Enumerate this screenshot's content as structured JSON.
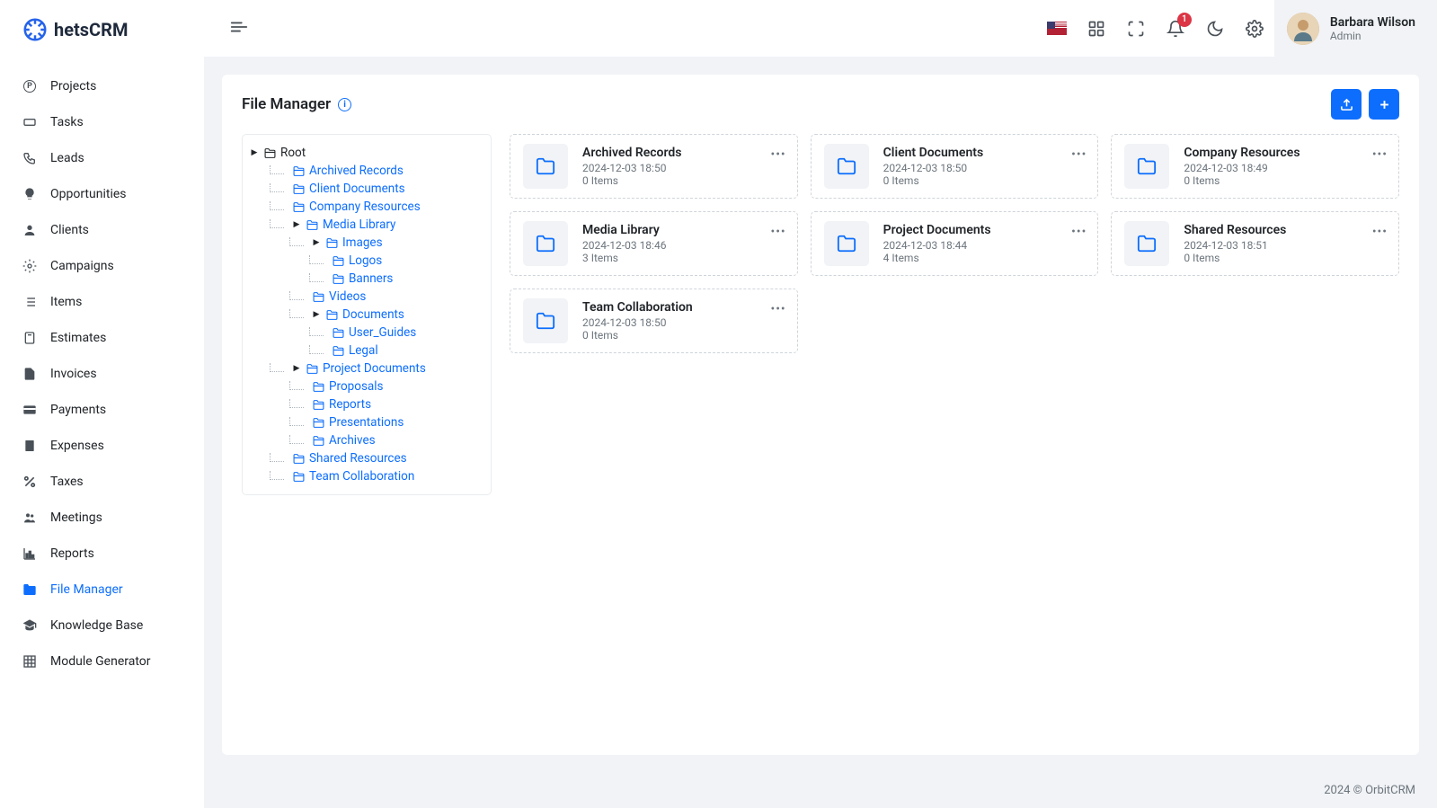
{
  "brand": {
    "prefix": "C",
    "suffix": "hetsCRM"
  },
  "user": {
    "name": "Barbara Wilson",
    "role": "Admin"
  },
  "notifications": {
    "count": "1"
  },
  "nav": [
    {
      "label": "Projects",
      "icon": "P"
    },
    {
      "label": "Tasks",
      "icon": "ticket"
    },
    {
      "label": "Leads",
      "icon": "phone"
    },
    {
      "label": "Opportunities",
      "icon": "bulb"
    },
    {
      "label": "Clients",
      "icon": "user"
    },
    {
      "label": "Campaigns",
      "icon": "gear"
    },
    {
      "label": "Items",
      "icon": "list"
    },
    {
      "label": "Estimates",
      "icon": "calc"
    },
    {
      "label": "Invoices",
      "icon": "file"
    },
    {
      "label": "Payments",
      "icon": "card"
    },
    {
      "label": "Expenses",
      "icon": "receipt"
    },
    {
      "label": "Taxes",
      "icon": "percent"
    },
    {
      "label": "Meetings",
      "icon": "group"
    },
    {
      "label": "Reports",
      "icon": "chart"
    },
    {
      "label": "File Manager",
      "icon": "folder",
      "active": true
    },
    {
      "label": "Knowledge Base",
      "icon": "grad"
    },
    {
      "label": "Module Generator",
      "icon": "grid"
    }
  ],
  "page": {
    "title": "File Manager"
  },
  "tree": {
    "root": "Root",
    "nodes": {
      "archived": "Archived Records",
      "client_docs": "Client Documents",
      "company_res": "Company Resources",
      "media": "Media Library",
      "images": "Images",
      "logos": "Logos",
      "banners": "Banners",
      "videos": "Videos",
      "docs": "Documents",
      "user_guides": "User_Guides",
      "legal": "Legal",
      "project_docs": "Project Documents",
      "proposals": "Proposals",
      "reports": "Reports",
      "presentations": "Presentations",
      "archives": "Archives",
      "shared": "Shared Resources",
      "team": "Team Collaboration"
    }
  },
  "folders": [
    {
      "name": "Archived Records",
      "date": "2024-12-03 18:50",
      "items": "0 Items"
    },
    {
      "name": "Client Documents",
      "date": "2024-12-03 18:50",
      "items": "0 Items"
    },
    {
      "name": "Company Resources",
      "date": "2024-12-03 18:49",
      "items": "0 Items"
    },
    {
      "name": "Media Library",
      "date": "2024-12-03 18:46",
      "items": "3 Items"
    },
    {
      "name": "Project Documents",
      "date": "2024-12-03 18:44",
      "items": "4 Items"
    },
    {
      "name": "Shared Resources",
      "date": "2024-12-03 18:51",
      "items": "0 Items"
    },
    {
      "name": "Team Collaboration",
      "date": "2024-12-03 18:50",
      "items": "0 Items"
    }
  ],
  "footer": {
    "text": "2024 © OrbitCRM"
  }
}
